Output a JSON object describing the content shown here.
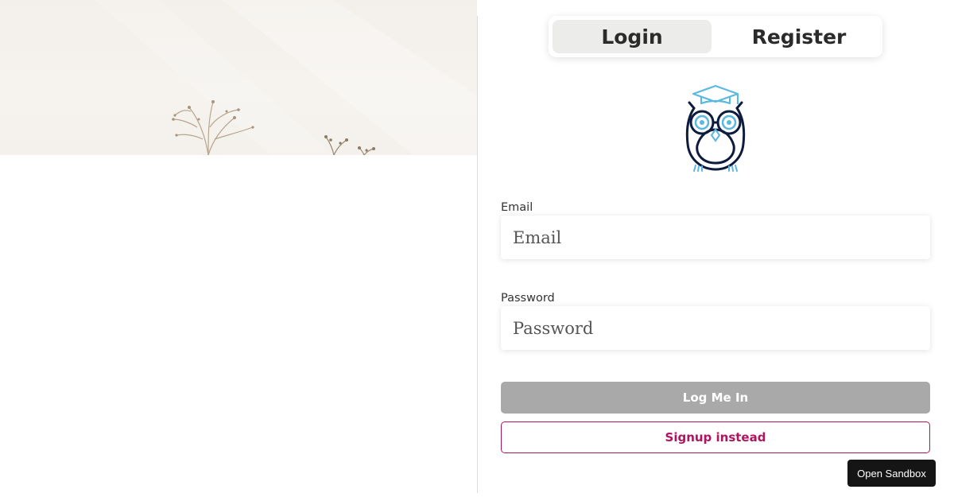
{
  "tabs": {
    "login": "Login",
    "register": "Register"
  },
  "form": {
    "email_label": "Email",
    "email_placeholder": "Email",
    "email_value": "",
    "password_label": "Password",
    "password_placeholder": "Password",
    "password_value": ""
  },
  "buttons": {
    "login": "Log Me In",
    "signup": "Signup instead"
  },
  "sandbox_button": "Open Sandbox",
  "colors": {
    "accent": "#b0145e",
    "disabled_button": "#a9a9a9",
    "logo_blue": "#5bb8e0",
    "logo_navy": "#0d1b3d"
  },
  "icons": {
    "logo": "owl-graduate-icon"
  }
}
